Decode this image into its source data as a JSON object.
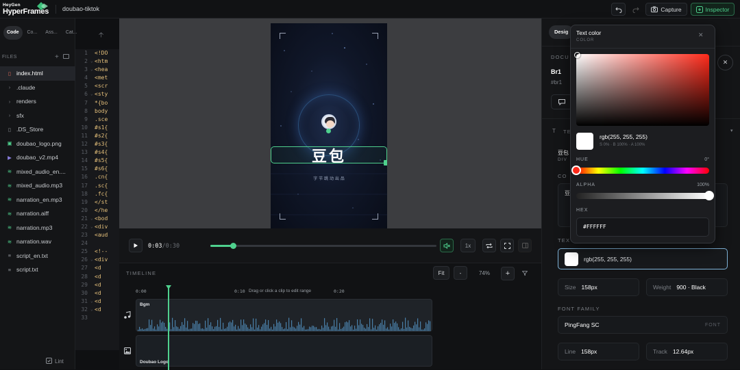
{
  "app": {
    "brand_small": "HeyGen",
    "brand_large": "HyperFrames",
    "project_name": "doubao-tiktok"
  },
  "toolbar": {
    "capture_label": "Capture",
    "inspector_label": "Inspector"
  },
  "left_panel": {
    "tabs": [
      "Code",
      "Co...",
      "Ass...",
      "Cat..."
    ],
    "files_header": "FILES",
    "files": [
      {
        "name": "index.html",
        "icon": "html-file-icon"
      },
      {
        "name": ".claude",
        "icon": "folder-chevron-icon"
      },
      {
        "name": "renders",
        "icon": "folder-chevron-icon"
      },
      {
        "name": "sfx",
        "icon": "folder-chevron-icon"
      },
      {
        "name": ".DS_Store",
        "icon": "file-icon"
      },
      {
        "name": "doubao_logo.png",
        "icon": "image-file-icon"
      },
      {
        "name": "doubao_v2.mp4",
        "icon": "video-file-icon"
      },
      {
        "name": "mixed_audio_en....",
        "icon": "audio-file-icon"
      },
      {
        "name": "mixed_audio.mp3",
        "icon": "audio-file-icon"
      },
      {
        "name": "narration_en.mp3",
        "icon": "audio-file-icon"
      },
      {
        "name": "narration.aiff",
        "icon": "audio-file-icon"
      },
      {
        "name": "narration.mp3",
        "icon": "audio-file-icon"
      },
      {
        "name": "narration.wav",
        "icon": "audio-file-icon"
      },
      {
        "name": "script_en.txt",
        "icon": "text-file-icon"
      },
      {
        "name": "script.txt",
        "icon": "text-file-icon"
      }
    ],
    "lint_label": "Lint"
  },
  "code_lines": [
    {
      "n": "1",
      "t": "<!DO",
      "f": ""
    },
    {
      "n": "2",
      "t": "<htm",
      "f": "⌄"
    },
    {
      "n": "3",
      "t": "<hea",
      "f": "⌄"
    },
    {
      "n": "4",
      "t": "<met",
      "f": ""
    },
    {
      "n": "5",
      "t": "<scr",
      "f": ""
    },
    {
      "n": "6",
      "t": "<sty",
      "f": "⌄"
    },
    {
      "n": "7",
      "t": "*{bo",
      "f": ""
    },
    {
      "n": "8",
      "t": "body",
      "f": ""
    },
    {
      "n": "9",
      "t": ".sce",
      "f": ""
    },
    {
      "n": "10",
      "t": "#s1{",
      "f": ""
    },
    {
      "n": "11",
      "t": "#s2{",
      "f": ""
    },
    {
      "n": "12",
      "t": "#s3{",
      "f": ""
    },
    {
      "n": "13",
      "t": "#s4{",
      "f": ""
    },
    {
      "n": "14",
      "t": "#s5{",
      "f": ""
    },
    {
      "n": "15",
      "t": "#s6{",
      "f": ""
    },
    {
      "n": "16",
      "t": ".cn{",
      "f": ""
    },
    {
      "n": "17",
      "t": ".sc{",
      "f": ""
    },
    {
      "n": "18",
      "t": ".fc{",
      "f": ""
    },
    {
      "n": "19",
      "t": "</st",
      "f": ""
    },
    {
      "n": "20",
      "t": "</he",
      "f": ""
    },
    {
      "n": "21",
      "t": "<bod",
      "f": "⌄"
    },
    {
      "n": "22",
      "t": "<div",
      "f": "⌄"
    },
    {
      "n": "23",
      "t": "<aud",
      "f": ""
    },
    {
      "n": "24",
      "t": "",
      "f": ""
    },
    {
      "n": "25",
      "t": "<!--",
      "f": ""
    },
    {
      "n": "26",
      "t": "<div",
      "f": "⌄"
    },
    {
      "n": "27",
      "t": " <d",
      "f": ""
    },
    {
      "n": "28",
      "t": " <d",
      "f": ""
    },
    {
      "n": "29",
      "t": " <d",
      "f": ""
    },
    {
      "n": "30",
      "t": " <d",
      "f": ""
    },
    {
      "n": "31",
      "t": " <d",
      "f": "⌄"
    },
    {
      "n": "32",
      "t": " <d",
      "f": "⌄"
    },
    {
      "n": "33",
      "t": "",
      "f": ""
    }
  ],
  "preview": {
    "headline": "豆包",
    "subline": "字 节 跳 动 出 品"
  },
  "playback": {
    "current_time": "0:03",
    "total_time": "0:30",
    "progress": 0.1,
    "speed": "1x"
  },
  "timeline": {
    "header": "TIMELINE",
    "fit_label": "Fit",
    "zoom_out": "-",
    "zoom_in": "+",
    "zoom_level": "74%",
    "ruler": [
      "0:00",
      "0:10",
      "0:20"
    ],
    "hint": "Drag or click a clip to edit range",
    "tracks": [
      {
        "label": "Bgm",
        "icon": "music-note-icon"
      },
      {
        "label": "Doubao Logo",
        "icon": "image-icon"
      }
    ]
  },
  "right_panel": {
    "tab_design": "Desig",
    "doc_label": "DOCU",
    "element_name": "Br1",
    "element_id": "#br1",
    "text_section": "TE",
    "text_value": "豆包",
    "text_sub": "DIV",
    "content_label": "CO",
    "content_value": "豆",
    "text_color_section": "TEX",
    "text_color_value": "rgb(255, 255, 255)",
    "size_label": "Size",
    "size_value": "158px",
    "weight_label": "Weight",
    "weight_value": "900 · Black",
    "font_family_section": "FONT FAMILY",
    "font_family_value": "PingFang SC",
    "font_tag": "FONT",
    "line_label": "Line",
    "line_value": "158px",
    "track_label": "Track",
    "track_value": "12.64px"
  },
  "color_picker": {
    "title": "Text color",
    "subtitle": "COLOR",
    "rgb_value": "rgb(255, 255, 255)",
    "hsb_detail": "S 0%  ·  B 100%  ·  A 100%",
    "hue_label": "HUE",
    "hue_value": "0°",
    "hue_fraction": 0,
    "alpha_label": "ALPHA",
    "alpha_value": "100%",
    "alpha_fraction": 1,
    "hex_label": "HEX",
    "hex_value": "#FFFFFF"
  },
  "colors": {
    "accent_green": "#4fd18e",
    "text_white": "#ffffff",
    "hue_red": "#ff2a1a"
  }
}
